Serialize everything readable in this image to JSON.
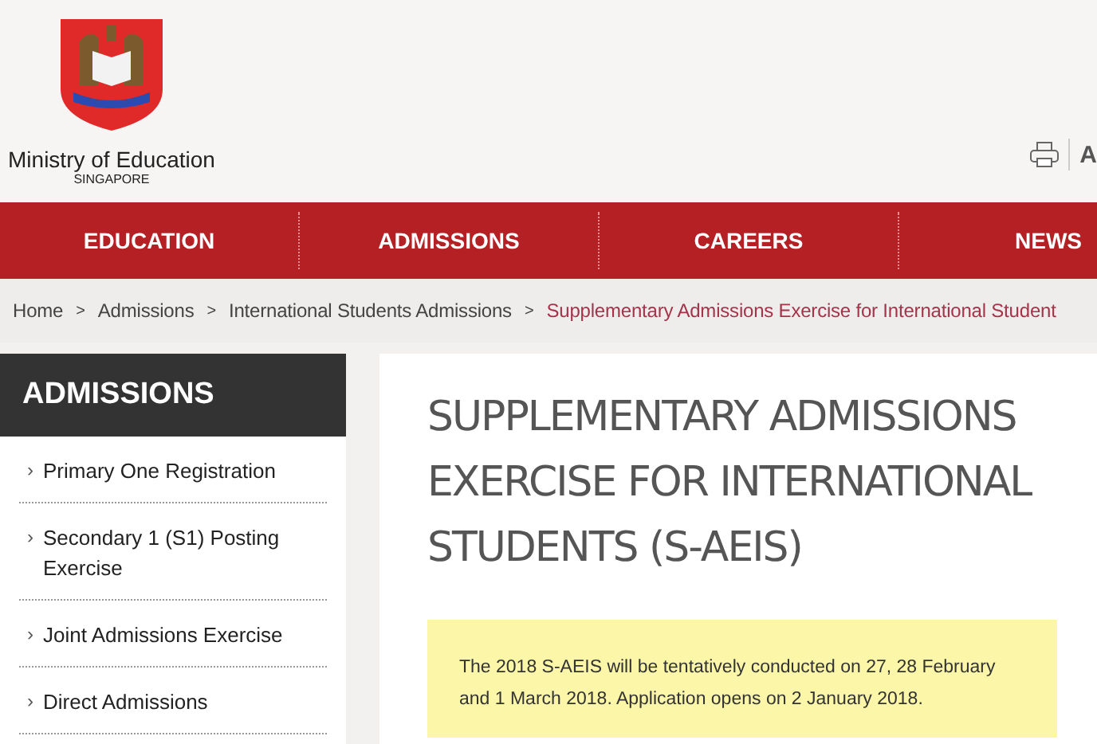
{
  "header": {
    "org_name": "Ministry of Education",
    "org_country": "SINGAPORE",
    "tools": [
      {
        "kind": "print"
      },
      {
        "kind": "text",
        "label": "A"
      }
    ]
  },
  "nav": [
    {
      "label": "EDUCATION",
      "selected": false
    },
    {
      "label": "ADMISSIONS",
      "selected": false
    },
    {
      "label": "CAREERS",
      "selected": false
    },
    {
      "label": "NEWS",
      "selected": false
    }
  ],
  "breadcrumb": [
    {
      "label": "Home",
      "current": false
    },
    {
      "label": "Admissions",
      "current": false
    },
    {
      "label": "International Students Admissions",
      "current": false
    },
    {
      "label": "Supplementary Admissions Exercise for International Student",
      "current": true
    }
  ],
  "breadcrumb_separator": ">",
  "sidebar": {
    "title": "ADMISSIONS",
    "items": [
      {
        "label": "Primary One Registration"
      },
      {
        "label": "Secondary 1 (S1) Posting Exercise"
      },
      {
        "label": "Joint Admissions Exercise"
      },
      {
        "label": "Direct Admissions"
      }
    ]
  },
  "sidebar_marker": "›",
  "page_title": "SUPPLEMENTARY ADMISSIONS EXERCISE FOR INTERNATIONAL STUDENTS (S-AEIS)",
  "notice": "The 2018 S-AEIS will be tentatively conducted on 27, 28 February and 1 March 2018. Application opens on 2 January 2018."
}
